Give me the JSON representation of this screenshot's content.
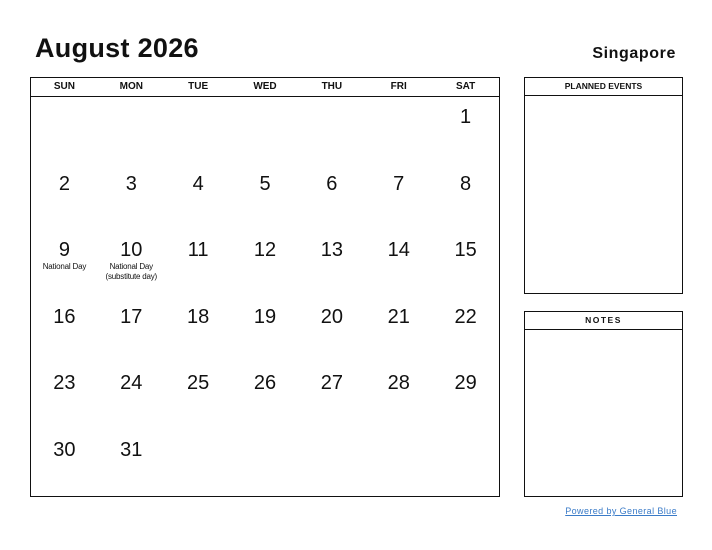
{
  "header": {
    "title": "August 2026",
    "country": "Singapore"
  },
  "calendar": {
    "weekdays": [
      "SUN",
      "MON",
      "TUE",
      "WED",
      "THU",
      "FRI",
      "SAT"
    ],
    "weeks": [
      [
        {
          "day": ""
        },
        {
          "day": ""
        },
        {
          "day": ""
        },
        {
          "day": ""
        },
        {
          "day": ""
        },
        {
          "day": ""
        },
        {
          "day": "1"
        }
      ],
      [
        {
          "day": "2"
        },
        {
          "day": "3"
        },
        {
          "day": "4"
        },
        {
          "day": "5"
        },
        {
          "day": "6"
        },
        {
          "day": "7"
        },
        {
          "day": "8"
        }
      ],
      [
        {
          "day": "9",
          "holiday": "National Day"
        },
        {
          "day": "10",
          "holiday": "National Day (substitute day)"
        },
        {
          "day": "11"
        },
        {
          "day": "12"
        },
        {
          "day": "13"
        },
        {
          "day": "14"
        },
        {
          "day": "15"
        }
      ],
      [
        {
          "day": "16"
        },
        {
          "day": "17"
        },
        {
          "day": "18"
        },
        {
          "day": "19"
        },
        {
          "day": "20"
        },
        {
          "day": "21"
        },
        {
          "day": "22"
        }
      ],
      [
        {
          "day": "23"
        },
        {
          "day": "24"
        },
        {
          "day": "25"
        },
        {
          "day": "26"
        },
        {
          "day": "27"
        },
        {
          "day": "28"
        },
        {
          "day": "29"
        }
      ],
      [
        {
          "day": "30"
        },
        {
          "day": "31"
        },
        {
          "day": ""
        },
        {
          "day": ""
        },
        {
          "day": ""
        },
        {
          "day": ""
        },
        {
          "day": ""
        }
      ]
    ]
  },
  "side": {
    "planned_events_label": "PLANNED EVENTS",
    "notes_label": "NOTES"
  },
  "footer": {
    "powered_by": "Powered by General Blue",
    "link_color": "#3a7bc8"
  }
}
